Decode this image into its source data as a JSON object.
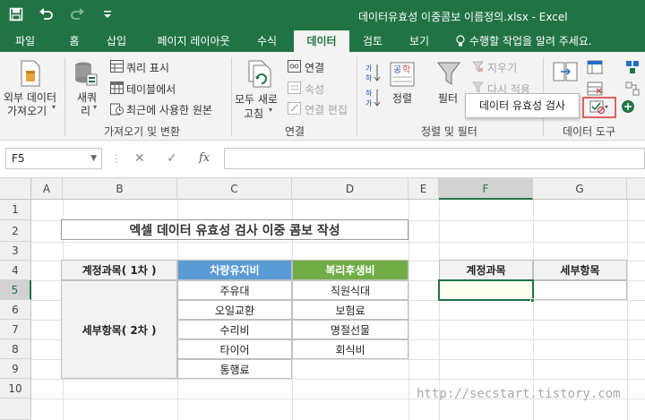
{
  "window": {
    "title": "데이터유효성 이중콤보 이름정의.xlsx - Excel"
  },
  "qat": {
    "icons": [
      "save-icon",
      "undo-icon",
      "redo-icon",
      "customize-icon"
    ]
  },
  "tabs": [
    {
      "label": "파일"
    },
    {
      "label": "홈"
    },
    {
      "label": "삽입"
    },
    {
      "label": "페이지 레이아웃"
    },
    {
      "label": "수식"
    },
    {
      "label": "데이터",
      "active": true
    },
    {
      "label": "검토"
    },
    {
      "label": "보기"
    },
    {
      "label": "수행할 작업을 알려 주세요."
    }
  ],
  "ribbon": {
    "get_external": {
      "line1": "외부 데이터",
      "line2": "가져오기"
    },
    "new_query": {
      "line1": "새쿼",
      "line2": "리"
    },
    "show_query": "쿼리 표시",
    "from_table": "테이블에서",
    "recent_sources": "최근에 사용한 원본",
    "group_get_transform": "가져오기 및 변환",
    "refresh_all": {
      "line1": "모두 새로",
      "line2": "고침"
    },
    "connections": "연결",
    "properties": "속성",
    "edit_links": "연결 편집",
    "group_connections": "연결",
    "sort": "정렬",
    "filter": "필터",
    "clear": "지우기",
    "reapply": "다시 적용",
    "group_sort_filter": "정렬 및 필터",
    "group_data_tools": "데이터 도구",
    "tooltip": "데이터 유효성 검사"
  },
  "formula_bar": {
    "name_box": "F5",
    "cancel_symbol": "✕",
    "enter_symbol": "✓",
    "fx_symbol": "fx",
    "formula": ""
  },
  "sheet": {
    "columns": [
      "A",
      "B",
      "C",
      "D",
      "E",
      "F",
      "G"
    ],
    "rows": [
      "1",
      "2",
      "3",
      "4",
      "5",
      "6",
      "7",
      "8",
      "9",
      "10"
    ],
    "selected_cell": "F5",
    "title": "엑셀 데이터 유효성 검사 이중 콤보 작성",
    "account_header": "계정과목( 1차 )",
    "detail_header": "세부항목( 2차 )",
    "col_c_header": "차량유지비",
    "col_d_header": "복리후생비",
    "col_c_items": [
      "주유대",
      "오일교환",
      "수리비",
      "타이어",
      "통행료"
    ],
    "col_d_items": [
      "직원식대",
      "보험료",
      "명절선물",
      "회식비"
    ],
    "lookup_header_f": "계정과목",
    "lookup_header_g": "세부항목",
    "header_blue": "#5b9bd5",
    "header_green": "#70ad47",
    "accent": "#217346"
  },
  "watermark": "http://secstart.tistory.com"
}
